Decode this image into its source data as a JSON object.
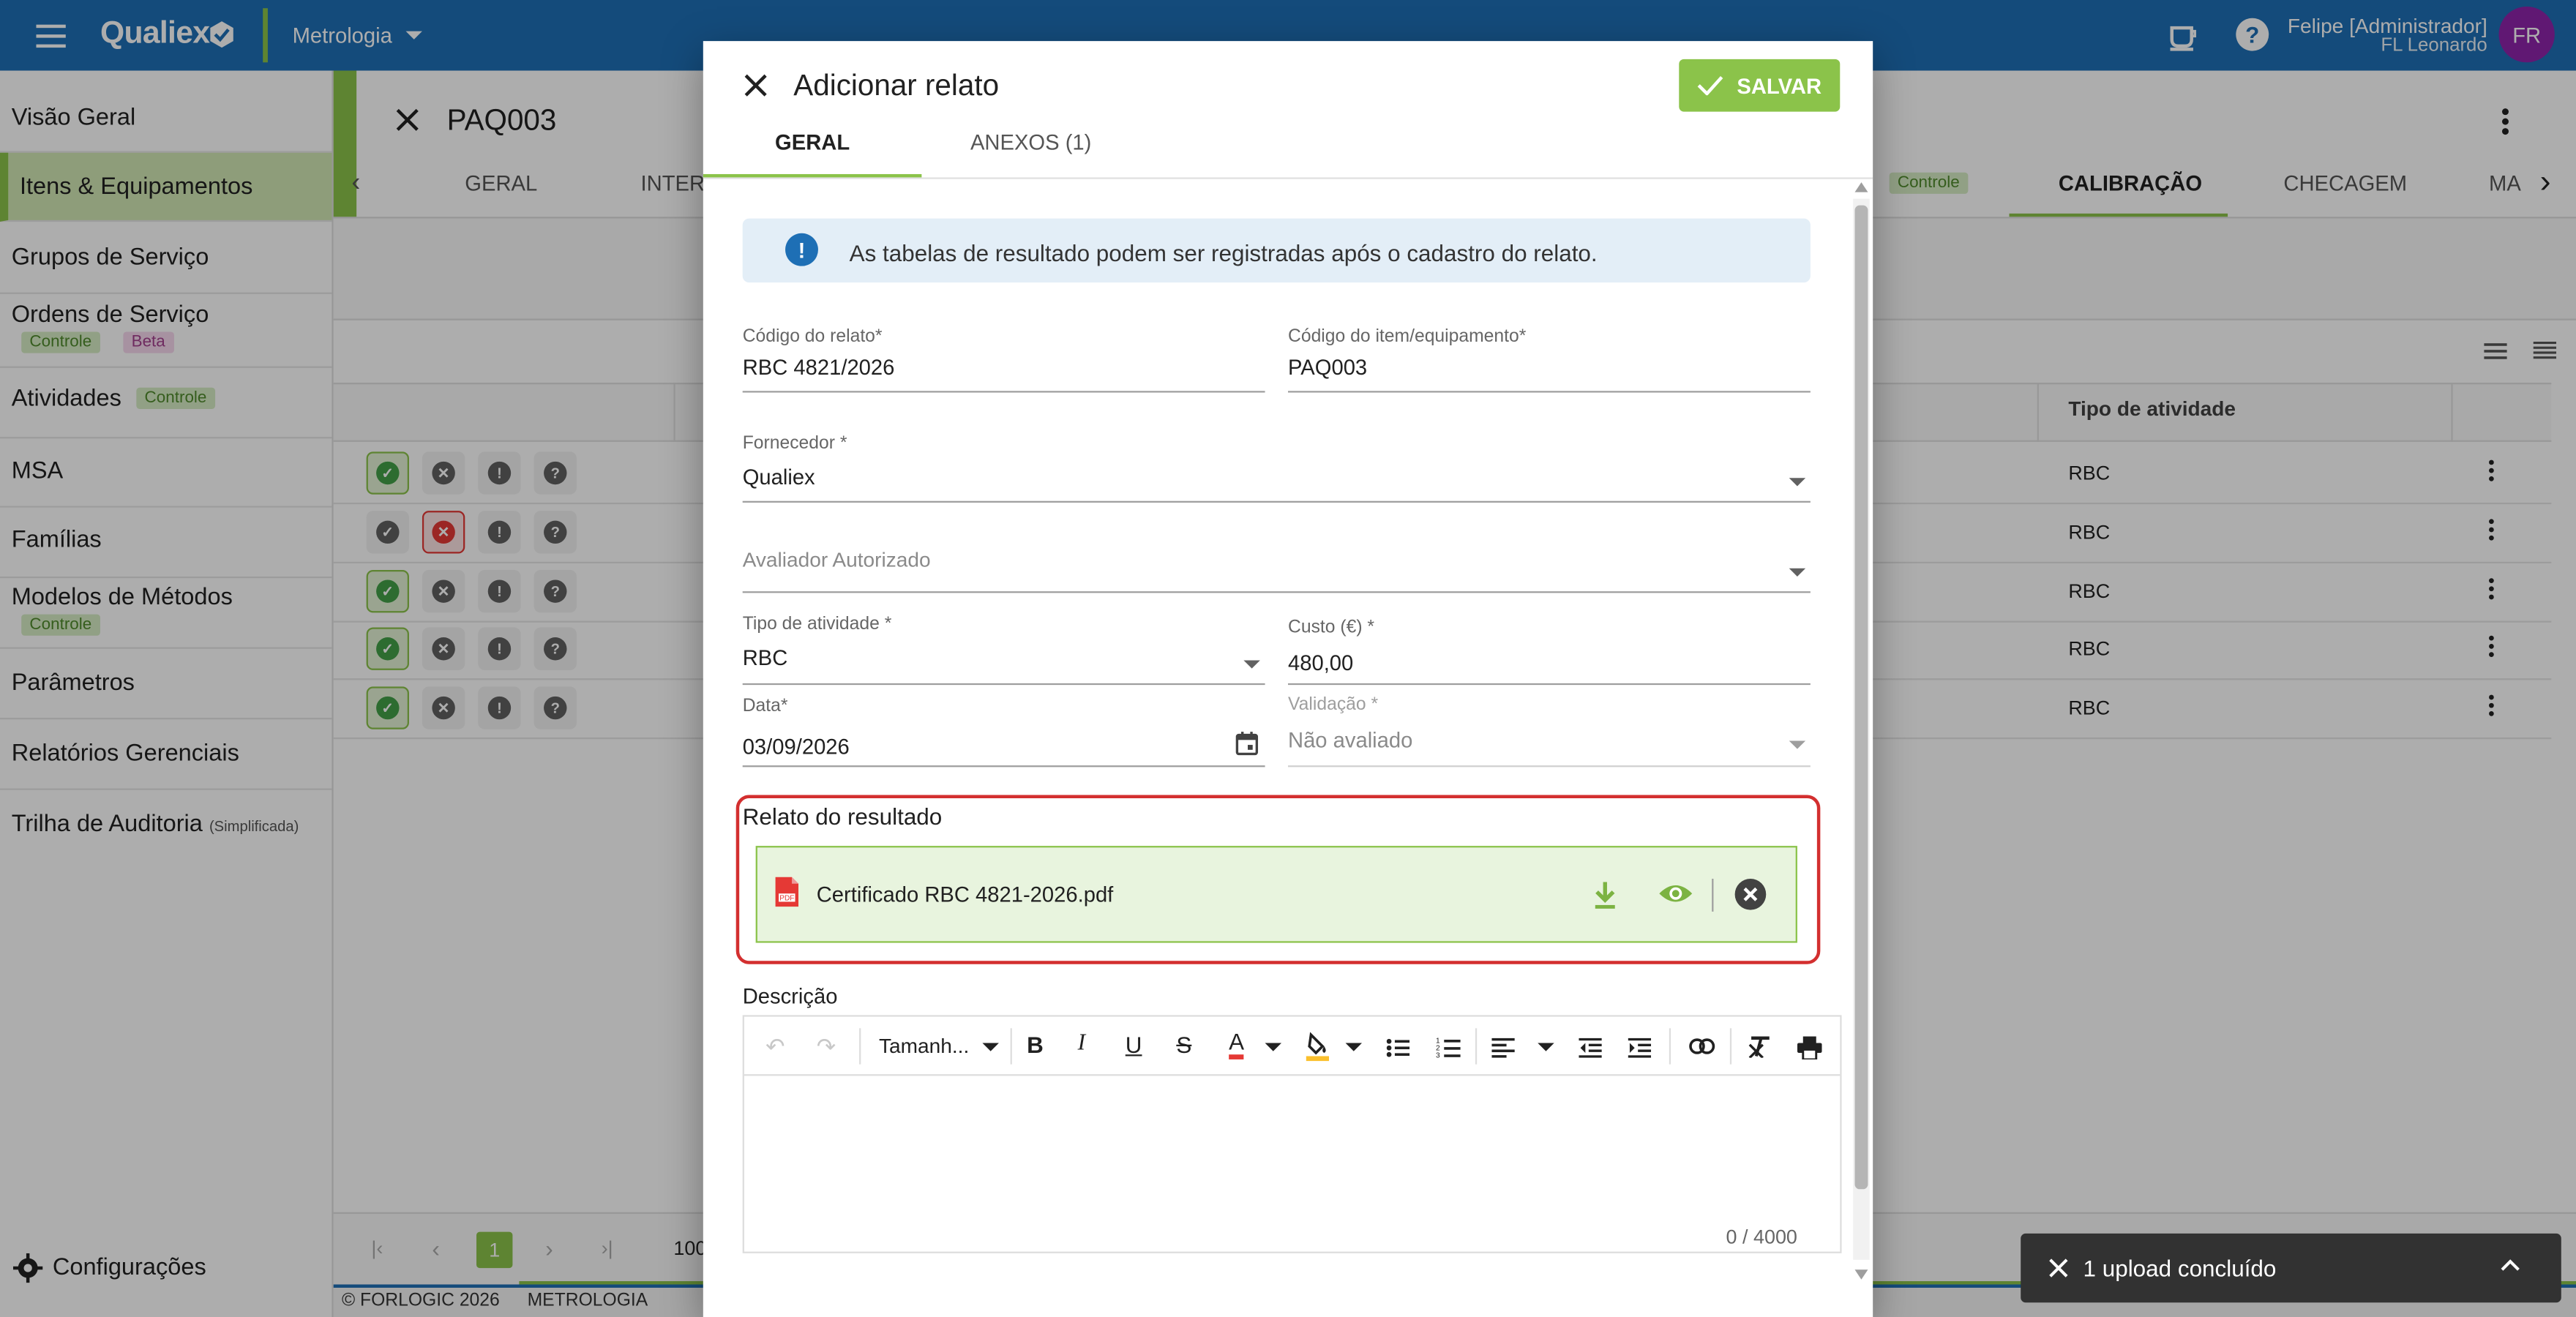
{
  "app": {
    "brand": "Qualiex",
    "module": "Metrologia",
    "user_name": "Felipe [Administrador]",
    "user_company": "FL Leonardo",
    "avatar_initials": "FR"
  },
  "sidebar": {
    "items": [
      {
        "label": "Visão Geral"
      },
      {
        "label": "Itens & Equipamentos",
        "active": true
      },
      {
        "label": "Grupos de Serviço"
      },
      {
        "label": "Ordens de Serviço",
        "tags": [
          "Controle",
          "Beta"
        ]
      },
      {
        "label": "Atividades",
        "tags": [
          "Controle"
        ]
      },
      {
        "label": "MSA"
      },
      {
        "label": "Famílias"
      },
      {
        "label": "Modelos de Métodos",
        "tags": [
          "Controle"
        ]
      },
      {
        "label": "Parâmetros"
      },
      {
        "label": "Relatórios Gerenciais"
      },
      {
        "label": "Trilha de Auditoria",
        "suffix": "(Simplificada)"
      }
    ],
    "settings_label": "Configurações"
  },
  "background": {
    "item_code": "PAQ003",
    "tabs": [
      "GERAL",
      "INTER",
      "CALIBRAÇÃO",
      "CHECAGEM",
      "MA"
    ],
    "tab_tag": "Controle",
    "active_tab": "CALIBRAÇÃO",
    "column_activity_type": "Tipo de atividade",
    "rows": [
      {
        "status": "ok",
        "activity": "RBC"
      },
      {
        "status": "fail",
        "activity": "RBC"
      },
      {
        "status": "ok",
        "activity": "RBC"
      },
      {
        "status": "ok",
        "activity": "RBC"
      },
      {
        "status": "ok",
        "activity": "RBC"
      }
    ],
    "pagination_page": "1",
    "page_size_partial": "100",
    "footer_copyright": "© FORLOGIC 2026",
    "footer_module": "METROLOGIA"
  },
  "modal": {
    "title": "Adicionar relato",
    "save_label": "SALVAR",
    "tabs": [
      {
        "label": "GERAL",
        "active": true
      },
      {
        "label": "ANEXOS (1)"
      }
    ],
    "info_message": "As tabelas de resultado podem ser registradas após o cadastro do relato.",
    "fields": {
      "report_code": {
        "label": "Código do relato*",
        "value": "RBC 4821/2026"
      },
      "item_code": {
        "label": "Código do item/equipamento*",
        "value": "PAQ003"
      },
      "supplier": {
        "label": "Fornecedor *",
        "value": "Qualiex"
      },
      "evaluator": {
        "placeholder": "Avaliador Autorizado"
      },
      "activity_type": {
        "label": "Tipo de atividade *",
        "value": "RBC"
      },
      "cost": {
        "label": "Custo (€) *",
        "value": "480,00"
      },
      "date": {
        "label": "Data*",
        "value": "03/09/2026"
      },
      "validation": {
        "label": "Validação *",
        "value": "Não avaliado"
      }
    },
    "result_report": {
      "label": "Relato do resultado",
      "file_name": "Certificado RBC 4821-2026.pdf",
      "file_badge": "PDF"
    },
    "description": {
      "label": "Descrição",
      "font_size_placeholder": "Tamanh...",
      "char_counter": "0 / 4000"
    }
  },
  "toast": {
    "message": "1 upload concluído"
  },
  "colors": {
    "primary": "#1e6fb5",
    "accent_green": "#8bc34a",
    "highlight_red": "#d32f2f",
    "avatar_purple": "#8e24aa"
  }
}
